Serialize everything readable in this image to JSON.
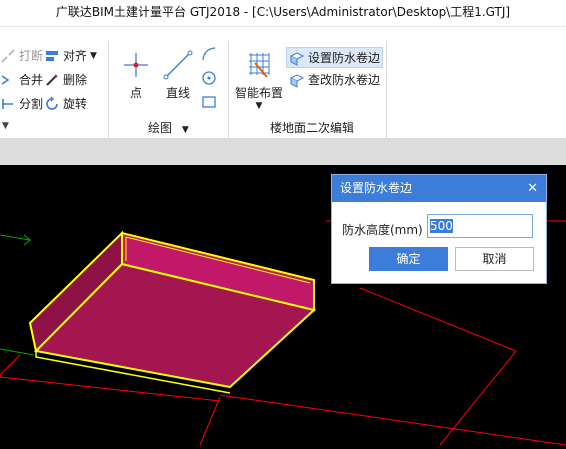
{
  "window": {
    "title": "广联达BIM土建计量平台 GTJ2018 - [C:\\Users\\Administrator\\Desktop\\工程1.GTJ]"
  },
  "ribbon": {
    "modify_group": {
      "items": [
        {
          "label": "打断",
          "icon": "break-icon"
        },
        {
          "label": "对齐",
          "icon": "align-icon"
        },
        {
          "label": "合并",
          "icon": "merge-icon"
        },
        {
          "label": "删除",
          "icon": "delete-icon"
        },
        {
          "label": "分割",
          "icon": "split-icon"
        },
        {
          "label": "旋转",
          "icon": "rotate-icon"
        }
      ]
    },
    "draw_group": {
      "label": "绘图",
      "point_label": "点",
      "line_label": "直线"
    },
    "floor_group": {
      "label": "楼地面二次编辑",
      "smart_layout_label": "智能布置",
      "set_waterproof_label": "设置防水卷边",
      "modify_waterproof_label": "查改防水卷边"
    }
  },
  "dialog": {
    "title": "设置防水卷边",
    "field_label": "防水高度(mm)",
    "field_value": "500",
    "ok_label": "确定",
    "cancel_label": "取消"
  },
  "colors": {
    "accent": "#3b7dd8",
    "slab_fill": "#a3164f",
    "outline": "#ffff00",
    "grid_red": "#ff0000",
    "axis_green": "#00aa00"
  }
}
